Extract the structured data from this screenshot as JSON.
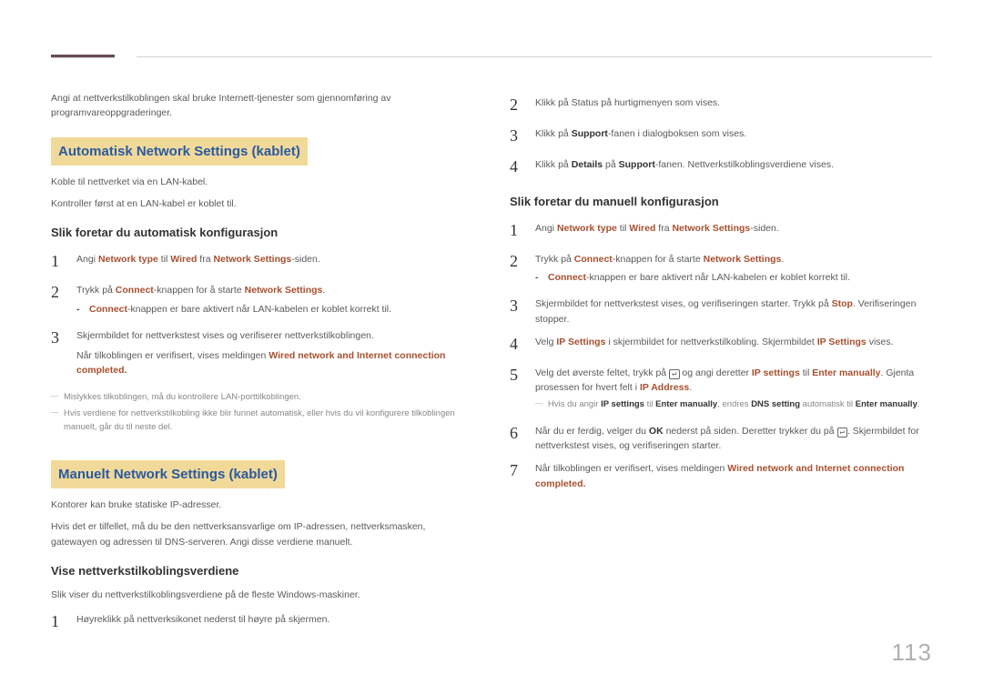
{
  "page_number": "113",
  "left": {
    "intro": "Angi at nettverkstilkoblingen skal bruke Internett-tjenester som gjennomføring av programvareoppgraderinger.",
    "section1_title": "Automatisk Network Settings  (kablet)",
    "sec1_p1": "Koble til nettverket via en LAN-kabel.",
    "sec1_p2": "Kontroller først at en LAN-kabel er koblet til.",
    "sub1": "Slik foretar du automatisk konfigurasjon",
    "s1_1a": "Angi ",
    "s1_1b": "Network type",
    "s1_1c": " til ",
    "s1_1d": "Wired",
    "s1_1e": " fra ",
    "s1_1f": "Network Settings",
    "s1_1g": "-siden.",
    "s1_2a": "Trykk på ",
    "s1_2b": "Connect",
    "s1_2c": "-knappen for å starte ",
    "s1_2d": "Network Settings",
    "s1_2e": ".",
    "s1_2na": "Connect",
    "s1_2nb": "-knappen er bare aktivert når LAN-kabelen er koblet korrekt til.",
    "s1_3": "Skjermbildet for nettverkstest vises og verifiserer nettverkstilkoblingen.",
    "s1_3b": "Når tilkoblingen er verifisert, vises meldingen ",
    "s1_3c": "Wired network and Internet connection completed.",
    "foot1": "Mislykkes tilkoblingen, må du kontrollere LAN-porttilkoblingen.",
    "foot2": "Hvis verdiene for nettverkstilkobling ikke blir funnet automatisk, eller hvis du vil konfigurere tilkoblingen manuelt, går du til neste del.",
    "section2_title": "Manuelt Network Settings (kablet)",
    "sec2_p1": "Kontorer kan bruke statiske IP-adresser.",
    "sec2_p2": "Hvis det er tilfellet, må du be den nettverksansvarlige om IP-adressen, nettverksmasken, gatewayen og adressen til DNS-serveren. Angi disse verdiene manuelt.",
    "sub2": "Vise nettverkstilkoblingsverdiene",
    "sec2_p3": "Slik viser du nettverkstilkoblingsverdiene på de fleste Windows-maskiner.",
    "s2_1": "Høyreklikk på nettverksikonet nederst til høyre på skjermen."
  },
  "right": {
    "r_2": "Klikk på Status på hurtigmenyen som vises.",
    "r_3a": "Klikk på ",
    "r_3b": "Support",
    "r_3c": "-fanen i dialogboksen som vises.",
    "r_4a": "Klikk på ",
    "r_4b": "Details",
    "r_4c": " på ",
    "r_4d": "Support",
    "r_4e": "-fanen. Nettverkstilkoblingsverdiene vises.",
    "sub3": "Slik foretar du manuell konfigurasjon",
    "m_1a": "Angi ",
    "m_1b": "Network type",
    "m_1c": " til ",
    "m_1d": "Wired",
    "m_1e": " fra ",
    "m_1f": "Network Settings",
    "m_1g": "-siden.",
    "m_2a": "Trykk på ",
    "m_2b": "Connect",
    "m_2c": "-knappen for å starte ",
    "m_2d": "Network Settings",
    "m_2e": ".",
    "m_2na": "Connect",
    "m_2nb": "-knappen er bare aktivert når LAN-kabelen er koblet korrekt til.",
    "m_3a": "Skjermbildet for nettverkstest vises, og verifiseringen starter. Trykk på ",
    "m_3b": "Stop",
    "m_3c": ". Verifiseringen stopper.",
    "m_4a": "Velg ",
    "m_4b": "IP Settings",
    "m_4c": " i skjermbildet for nettverkstilkobling. Skjermbildet ",
    "m_4d": "IP Settings",
    "m_4e": " vises.",
    "m_5a": "Velg det øverste feltet, trykk på ",
    "m_5icon": "↵",
    "m_5b": " og angi deretter ",
    "m_5c": "IP settings",
    "m_5d": " til ",
    "m_5e": "Enter manually",
    "m_5f": ". Gjenta prosessen for hvert felt i ",
    "m_5g": "IP Address",
    "m_5h": ".",
    "m_5fa": "Hvis du angir ",
    "m_5fb": "IP settings",
    "m_5fc": " til ",
    "m_5fd": "Enter manually",
    "m_5fe": ", endres ",
    "m_5ff": "DNS setting",
    "m_5fg": " automatisk til ",
    "m_5fh": "Enter manually",
    "m_5fi": ".",
    "m_6a": "Når du er ferdig, velger du ",
    "m_6b": "OK",
    "m_6c": " nederst på siden. Deretter trykker du på ",
    "m_6icon": "↵",
    "m_6d": ". Skjermbildet for nettverkstest vises, og verifiseringen starter.",
    "m_7a": "Når tilkoblingen er verifisert, vises meldingen ",
    "m_7b": "Wired network and Internet connection completed."
  }
}
